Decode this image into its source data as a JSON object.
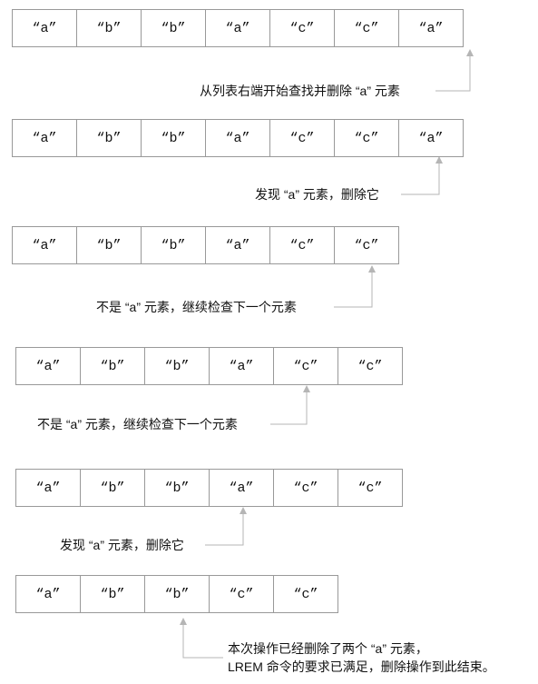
{
  "steps": [
    {
      "cells": [
        "“a”",
        "“b”",
        "“b”",
        "“a”",
        "“c”",
        "“c”",
        "“a”"
      ],
      "note": [
        "从列表右端开始查找并删除 “a” 元素"
      ]
    },
    {
      "cells": [
        "“a”",
        "“b”",
        "“b”",
        "“a”",
        "“c”",
        "“c”",
        "“a”"
      ],
      "note": [
        "发现 “a” 元素，删除它"
      ]
    },
    {
      "cells": [
        "“a”",
        "“b”",
        "“b”",
        "“a”",
        "“c”",
        "“c”"
      ],
      "note": [
        "不是 “a” 元素，继续检查下一个元素"
      ]
    },
    {
      "cells": [
        "“a”",
        "“b”",
        "“b”",
        "“a”",
        "“c”",
        "“c”"
      ],
      "note": [
        "不是 “a” 元素，继续检查下一个元素"
      ]
    },
    {
      "cells": [
        "“a”",
        "“b”",
        "“b”",
        "“a”",
        "“c”",
        "“c”"
      ],
      "note": [
        "发现 “a” 元素，删除它"
      ]
    },
    {
      "cells": [
        "“a”",
        "“b”",
        "“b”",
        "“c”",
        "“c”"
      ],
      "note": [
        "本次操作已经删除了两个 “a” 元素，",
        "LREM 命令的要求已满足，删除操作到此结束。"
      ]
    }
  ]
}
